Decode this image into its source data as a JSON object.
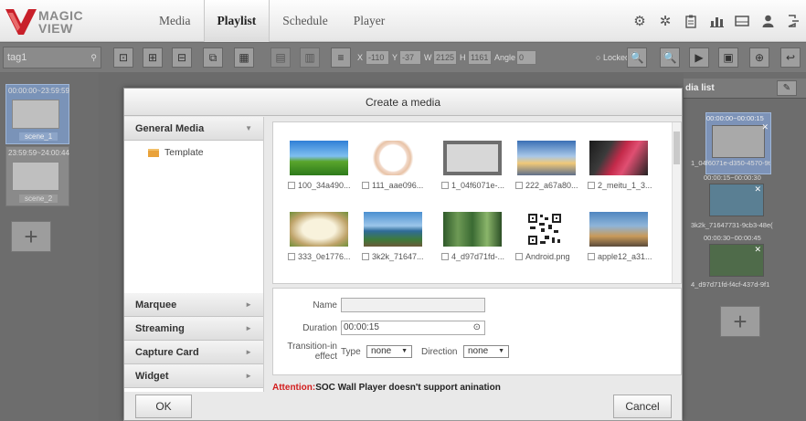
{
  "app": {
    "logo_line1": "MAGIC",
    "logo_line2": "VIEW"
  },
  "nav": {
    "tabs": [
      {
        "label": "Media"
      },
      {
        "label": "Playlist"
      },
      {
        "label": "Schedule"
      },
      {
        "label": "Player"
      }
    ],
    "active": "Playlist"
  },
  "top_icons": [
    "settings-gear-icon",
    "settings-icon",
    "clipboard-icon",
    "bar-chart-icon",
    "monitor-icon",
    "user-icon",
    "logout-icon"
  ],
  "toolbar": {
    "tag": "tag1",
    "x_label": "X",
    "x_value": "-110",
    "y_label": "Y",
    "y_value": "-37",
    "w_label": "W",
    "w_value": "2125",
    "h_label": "H",
    "h_value": "1161",
    "angle_label": "Angle",
    "angle_value": "0",
    "locked_label": "Locked"
  },
  "left_panel": {
    "scenes": [
      {
        "time": "00:00:00~23:59:59",
        "name": "scene_1"
      },
      {
        "time": "23:59:59~24:00:44",
        "name": "scene_2"
      }
    ]
  },
  "right_panel": {
    "title": "dia list",
    "items": [
      {
        "time": "00:00:00~00:00:15",
        "name": "1_04f6071e-d350-4570-9t"
      },
      {
        "time": "00:00:15~00:00:30",
        "name": "3k2k_71647731-9cb3-48e("
      },
      {
        "time": "00:00:30~00:00:45",
        "name": "4_d97d71fd-f4cf-437d-9f1"
      }
    ]
  },
  "modal": {
    "title": "Create a media",
    "categories": {
      "general": "General Media",
      "template": "Template",
      "marquee": "Marquee",
      "streaming": "Streaming",
      "capture": "Capture Card",
      "widget": "Widget"
    },
    "media_items": [
      {
        "name": "100_34a490...",
        "icon": "landscape-thumbnail"
      },
      {
        "name": "111_aae096...",
        "icon": "flower-wreath-thumbnail"
      },
      {
        "name": "1_04f6071e-...",
        "icon": "screen-thumbnail"
      },
      {
        "name": "222_a67a80...",
        "icon": "sunset-thumbnail"
      },
      {
        "name": "2_meitu_1_3...",
        "icon": "phones-thumbnail"
      },
      {
        "name": "333_0e1776...",
        "icon": "frame-thumbnail"
      },
      {
        "name": "3k2k_71647...",
        "icon": "coast-thumbnail"
      },
      {
        "name": "4_d97d71fd-...",
        "icon": "trees-thumbnail"
      },
      {
        "name": "Android.png",
        "icon": "qr-code-thumbnail"
      },
      {
        "name": "apple12_a31...",
        "icon": "stage-thumbnail"
      }
    ],
    "form": {
      "name_label": "Name",
      "name_value": "",
      "duration_label": "Duration",
      "duration_value": "00:00:15",
      "transition_label_1": "Transition-in",
      "transition_label_2": "effect",
      "type_label": "Type",
      "type_value": "none",
      "direction_label": "Direction",
      "direction_value": "none"
    },
    "attention_prefix": "Attention:",
    "attention_text": "SOC Wall Player doesn't support anination",
    "ok_label": "OK",
    "cancel_label": "Cancel"
  },
  "colors": {
    "logo_red": "#c8202a",
    "attention_red": "#d21d1d",
    "folder": "#e9a23b",
    "selection_border": "#7a97c8"
  }
}
